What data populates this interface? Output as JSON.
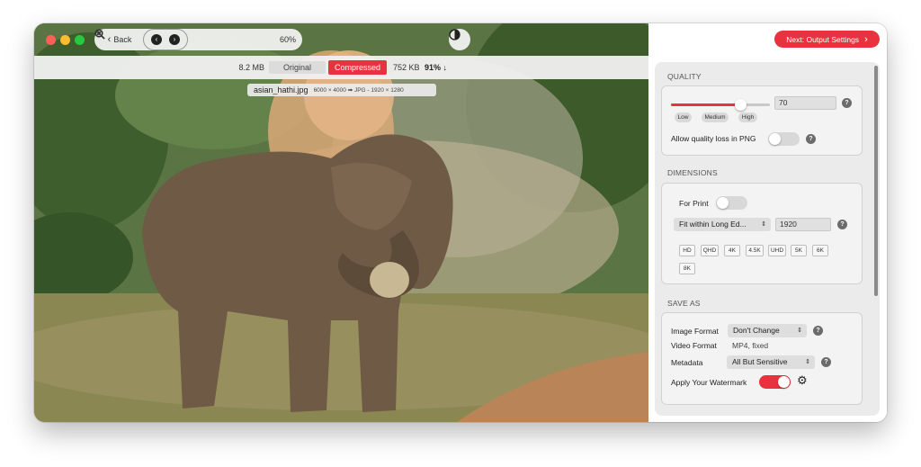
{
  "toolbar": {
    "back_label": "Back",
    "zoom_level": "60%",
    "icons": [
      "chevron-left-icon",
      "prev-circle-icon",
      "next-circle-icon",
      "zoom-in-icon",
      "zoom-out-icon",
      "zoom-fit-icon",
      "zoom-actual-icon",
      "contrast-icon"
    ]
  },
  "compare": {
    "original_size": "8.2 MB",
    "original_label": "Original",
    "compressed_label": "Compressed",
    "compressed_size": "752 KB",
    "reduction": "91% ↓"
  },
  "file": {
    "name": "asian_hathi.jpg",
    "details": "6000 × 4000 ➡ JPG - 1920 × 1280"
  },
  "next_button": {
    "label": "Next: Output Settings"
  },
  "quality": {
    "title": "QUALITY",
    "value": "70",
    "slider_fraction": 0.7,
    "presets": [
      "Low",
      "Medium",
      "High"
    ],
    "png_loss_label": "Allow quality loss in PNG",
    "png_loss_enabled": false
  },
  "dimensions": {
    "title": "DIMENSIONS",
    "for_print_label": "For Print",
    "for_print_enabled": false,
    "fit_mode": "Fit within Long Ed...",
    "size_value": "1920",
    "presets": [
      "HD",
      "QHD",
      "4K",
      "4.5K",
      "UHD",
      "5K",
      "6K",
      "8K"
    ]
  },
  "save_as": {
    "title": "SAVE AS",
    "image_format_label": "Image Format",
    "image_format_value": "Don't Change",
    "video_format_label": "Video Format",
    "video_format_value": "MP4, fixed",
    "metadata_label": "Metadata",
    "metadata_value": "All But Sensitive",
    "watermark_label": "Apply Your Watermark",
    "watermark_enabled": true
  },
  "colors": {
    "accent": "#e9323d",
    "panel_bg": "#ebebeb"
  }
}
